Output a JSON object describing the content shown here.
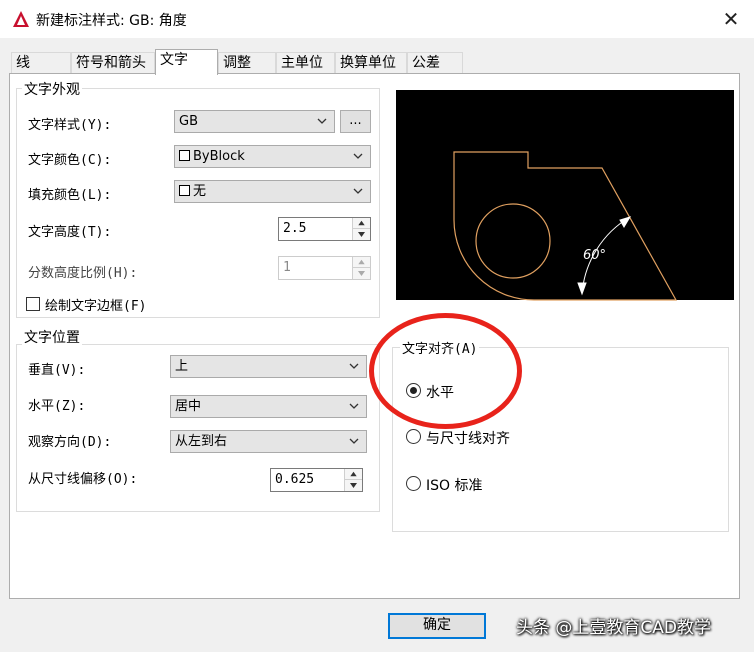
{
  "window": {
    "title": "新建标注样式: GB: 角度",
    "close_glyph": "✕"
  },
  "tabs": [
    {
      "label": "线",
      "active": false
    },
    {
      "label": "符号和箭头",
      "active": false
    },
    {
      "label": "文字",
      "active": true
    },
    {
      "label": "调整",
      "active": false
    },
    {
      "label": "主单位",
      "active": false
    },
    {
      "label": "换算单位",
      "active": false
    },
    {
      "label": "公差",
      "active": false
    }
  ],
  "text_appearance": {
    "group_title": "文字外观",
    "style_label": "文字样式(Y):",
    "style_value": "GB",
    "style_browse_label": "...",
    "color_label": "文字颜色(C):",
    "color_value": "ByBlock",
    "fill_label": "填充颜色(L):",
    "fill_value": "无",
    "height_label": "文字高度(T):",
    "height_value": "2.5",
    "fraction_label": "分数高度比例(H):",
    "fraction_value": "1",
    "frame_label": "绘制文字边框(F)",
    "frame_checked": false
  },
  "text_placement": {
    "group_title": "文字位置",
    "vertical_label": "垂直(V):",
    "vertical_value": "上",
    "horizontal_label": "水平(Z):",
    "horizontal_value": "居中",
    "view_dir_label": "观察方向(D):",
    "view_dir_value": "从左到右",
    "offset_label": "从尺寸线偏移(O):",
    "offset_value": "0.625"
  },
  "text_alignment": {
    "group_title": "文字对齐(A)",
    "options": [
      {
        "label": "水平",
        "checked": true
      },
      {
        "label": "与尺寸线对齐",
        "checked": false
      },
      {
        "label": "ISO 标准",
        "checked": false
      }
    ]
  },
  "preview": {
    "angle_label": "60°",
    "background_color": "#000000",
    "geometry_color": "#e0a060",
    "dimension_color": "#ffffff"
  },
  "footer": {
    "ok_label": "确定",
    "watermark": "头条 @上壹教育CAD教学"
  },
  "colors": {
    "highlight_ring": "#e8231b",
    "focus_blue": "#0078d7"
  }
}
